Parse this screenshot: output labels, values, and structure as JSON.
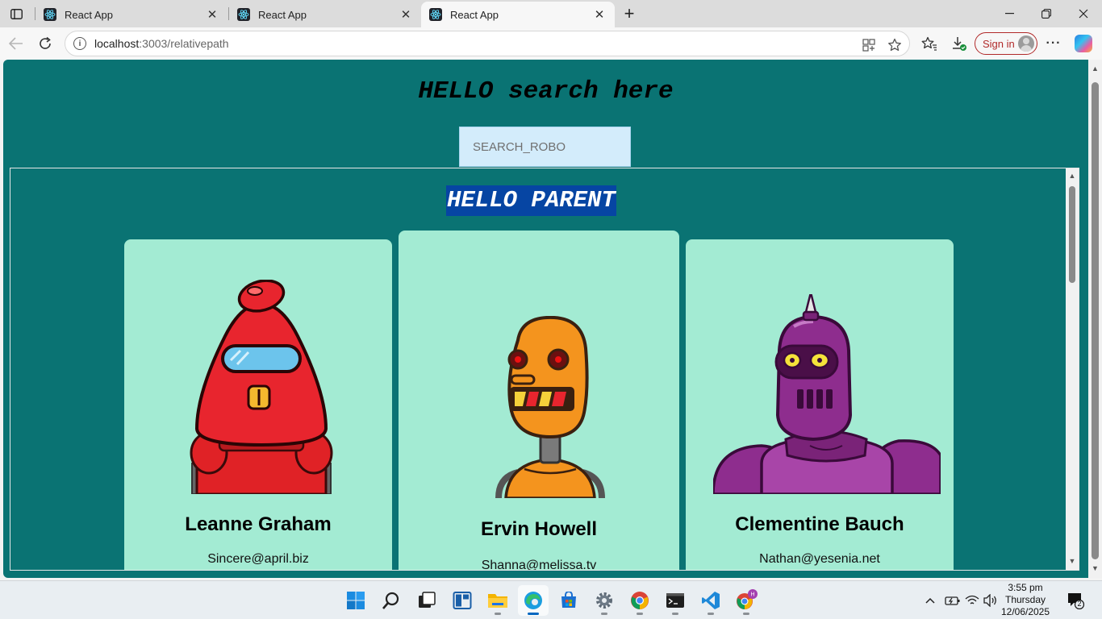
{
  "browser": {
    "tabs": [
      {
        "title": "React App",
        "active": false
      },
      {
        "title": "React App",
        "active": false
      },
      {
        "title": "React App",
        "active": true
      }
    ],
    "url_host": "localhost",
    "url_rest": ":3003/relativepath",
    "sign_in_label": "Sign in"
  },
  "page": {
    "title": "HELLO search here",
    "search_placeholder": "SEARCH_ROBO",
    "parent_title": "HELLO PARENT",
    "robots": [
      {
        "name": "Leanne Graham",
        "email": "Sincere@april.biz",
        "color": "#e8252e"
      },
      {
        "name": "Ervin Howell",
        "email": "Shanna@melissa.tv",
        "color": "#f4941e"
      },
      {
        "name": "Clementine Bauch",
        "email": "Nathan@yesenia.net",
        "color": "#8e2d8e"
      }
    ]
  },
  "taskbar": {
    "apps": [
      "start-icon",
      "search-icon",
      "task-view-icon",
      "widgets-icon",
      "file-explorer-icon",
      "edge-icon",
      "store-icon",
      "settings-icon",
      "chrome-icon",
      "terminal-icon",
      "vscode-icon",
      "chrome-profile-icon"
    ],
    "time": "3:55 pm",
    "day": "Thursday",
    "date": "12/06/2025",
    "notification_count": "2"
  },
  "colors": {
    "page_bg": "#0a7373",
    "card_bg": "#a3ebd3",
    "parent_title_bg": "#0645a3",
    "search_bg": "#d3ecfb"
  }
}
